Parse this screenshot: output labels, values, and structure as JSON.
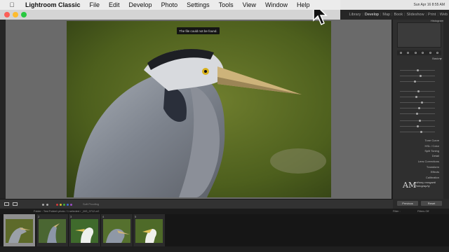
{
  "menubar": {
    "apple_icon": "apple-logo-icon",
    "app_name": "Lightroom Classic",
    "items": [
      "File",
      "Edit",
      "Develop",
      "Photo",
      "Settings",
      "Tools",
      "View",
      "Window",
      "Help"
    ],
    "status_time": "Sun Apr 16  8:55 AM"
  },
  "modules": {
    "items": [
      "Library",
      "Develop",
      "Map",
      "Book",
      "Slideshow",
      "Print",
      "Web"
    ],
    "active": "Develop"
  },
  "canvas": {
    "toast": "The file could not be found."
  },
  "right_panel": {
    "navigator_label": "Histogram",
    "basic_label": "Basic",
    "sections": [
      "Tone Curve",
      "HSL / Color",
      "Split Toning",
      "Detail",
      "Lens Corrections",
      "Transform",
      "Effects",
      "Calibration"
    ]
  },
  "watermark": {
    "mark": "AM",
    "line1": "anthony morganti",
    "line2": "Photography"
  },
  "toolbar": {
    "soft_proofing": "Soft Proofing",
    "previous_label": "Previous",
    "reset_label": "Reset"
  },
  "filmstrip_header": {
    "left": "Folder : Test Folder",
    "info": "1 photo / 1 selected / _MG_0712.cr2",
    "filter": "Filter :",
    "filter_value": "Filters Off"
  },
  "filmstrip": {
    "numbers": [
      "1",
      "2",
      "3",
      "4",
      "5"
    ],
    "selected_index": 0
  },
  "colors": {
    "accent_red": "#fc5f57",
    "accent_yellow": "#fdbc2e",
    "accent_green": "#28c840",
    "panel": "#2f2f2f"
  }
}
